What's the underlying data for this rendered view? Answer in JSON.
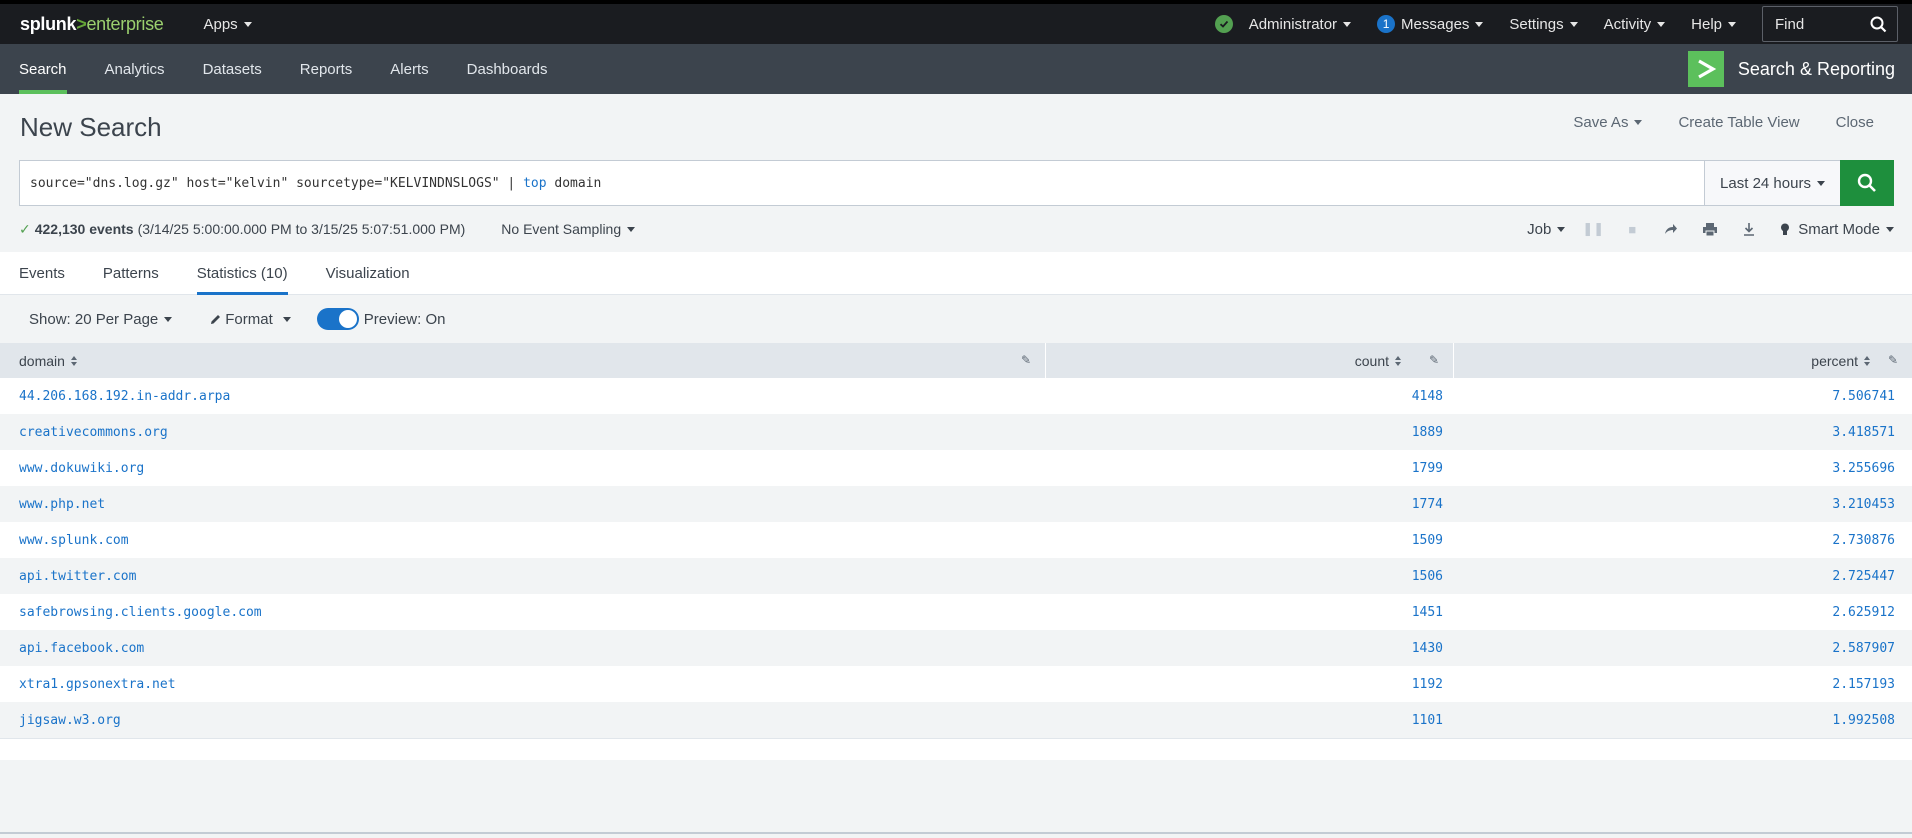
{
  "topbar": {
    "logo": {
      "part1": "splunk",
      "part2": ">",
      "part3": "enterprise"
    },
    "apps_label": "Apps",
    "user_label": "Administrator",
    "messages_count": "1",
    "messages_label": "Messages",
    "settings_label": "Settings",
    "activity_label": "Activity",
    "help_label": "Help",
    "find_label": "Find"
  },
  "appnav": {
    "tabs": [
      "Search",
      "Analytics",
      "Datasets",
      "Reports",
      "Alerts",
      "Dashboards"
    ],
    "app_title": "Search & Reporting"
  },
  "search": {
    "page_title": "New Search",
    "save_as_label": "Save As",
    "create_table_label": "Create Table View",
    "close_label": "Close",
    "query_prefix": "source=\"dns.log.gz\" host=\"kelvin\" sourcetype=\"KELVINDNSLOGS\" | ",
    "query_command": "top",
    "query_suffix": " domain",
    "time_range": "Last 24 hours"
  },
  "job": {
    "events_count": "422,130 events",
    "time_span": "(3/14/25 5:00:00.000 PM to 3/15/25 5:07:51.000 PM)",
    "sampling_label": "No Event Sampling",
    "job_label": "Job",
    "mode_label": "Smart Mode"
  },
  "results_tabs": [
    "Events",
    "Patterns",
    "Statistics (10)",
    "Visualization"
  ],
  "controls": {
    "show_label": "Show: 20 Per Page",
    "format_label": "Format",
    "preview_label": "Preview: On"
  },
  "table": {
    "columns": [
      "domain",
      "count",
      "percent"
    ],
    "rows": [
      {
        "domain": "44.206.168.192.in-addr.arpa",
        "count": "4148",
        "percent": "7.506741"
      },
      {
        "domain": "creativecommons.org",
        "count": "1889",
        "percent": "3.418571"
      },
      {
        "domain": "www.dokuwiki.org",
        "count": "1799",
        "percent": "3.255696"
      },
      {
        "domain": "www.php.net",
        "count": "1774",
        "percent": "3.210453"
      },
      {
        "domain": "www.splunk.com",
        "count": "1509",
        "percent": "2.730876"
      },
      {
        "domain": "api.twitter.com",
        "count": "1506",
        "percent": "2.725447"
      },
      {
        "domain": "safebrowsing.clients.google.com",
        "count": "1451",
        "percent": "2.625912"
      },
      {
        "domain": "api.facebook.com",
        "count": "1430",
        "percent": "2.587907"
      },
      {
        "domain": "xtra1.gpsonextra.net",
        "count": "1192",
        "percent": "2.157193"
      },
      {
        "domain": "jigsaw.w3.org",
        "count": "1101",
        "percent": "1.992508"
      }
    ]
  },
  "colors": {
    "accent_green": "#5cc05c",
    "link_blue": "#1a73c9",
    "search_button": "#1e8f3d"
  }
}
